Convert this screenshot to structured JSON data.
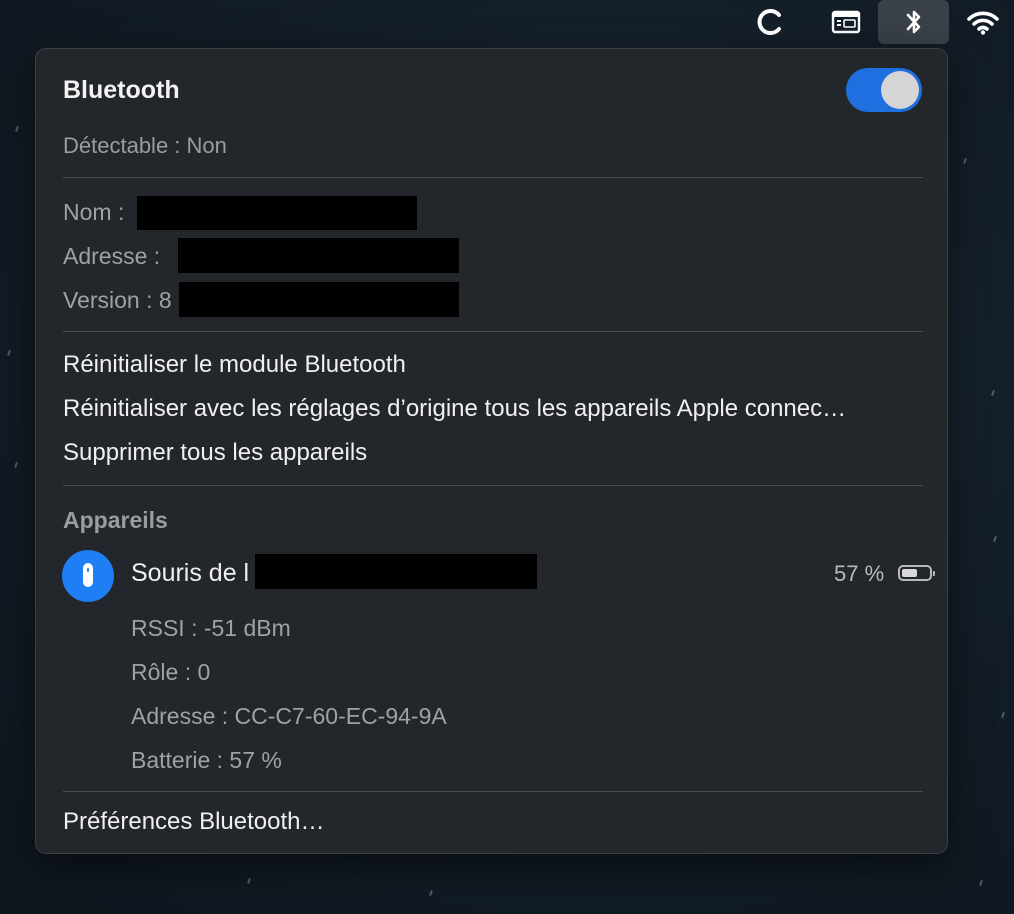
{
  "menubar": {
    "icons": [
      "reload-icon",
      "keyboard-viewer-icon",
      "bluetooth-icon",
      "wifi-icon"
    ]
  },
  "panel": {
    "title": "Bluetooth",
    "toggle_on": true,
    "discoverable": "Détectable : Non",
    "info": {
      "name_label": "Nom :",
      "address_label": "Adresse :",
      "version_label": "Version : 8"
    },
    "actions": {
      "reset_module": "Réinitialiser le module Bluetooth",
      "factory_reset": "Réinitialiser avec les réglages d’origine tous les appareils Apple connec…",
      "remove_all": "Supprimer tous les appareils"
    },
    "devices_title": "Appareils",
    "device": {
      "name": "Souris de l",
      "battery_label": "57 %",
      "battery_level": 0.57,
      "rssi": "RSSI : -51 dBm",
      "role": "Rôle : 0",
      "address": "Adresse : CC-C7-60-EC-94-9A",
      "battery": "Batterie : 57 %"
    },
    "preferences": "Préférences Bluetooth…"
  },
  "colors": {
    "toggle_on": "#1f6fe0",
    "device_icon": "#1e7ff5",
    "panel_bg": "#23262b"
  }
}
